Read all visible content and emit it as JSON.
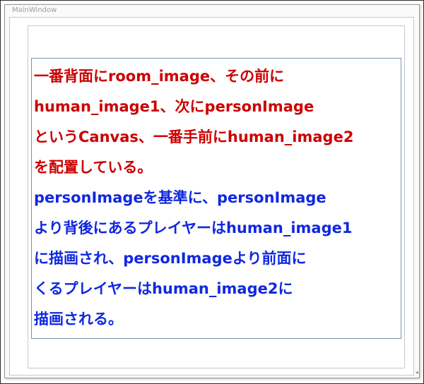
{
  "window": {
    "title": "MainWindow"
  },
  "content": {
    "red_lines": [
      "一番背面にroom_image、その前に",
      "human_image1、次にpersonImage",
      "というCanvas、一番手前にhuman_image2",
      "を配置している。"
    ],
    "blue_lines": [
      "personImageを基準に、personImage",
      "より背後にあるプレイヤーはhuman_image1",
      "に描画され、personImageより前面に",
      "くるプレイヤーはhuman_image2に",
      "描画される。"
    ]
  },
  "colors": {
    "red_text": "#cc0000",
    "blue_text": "#1028e0",
    "panel_border": "#7b93b3"
  }
}
